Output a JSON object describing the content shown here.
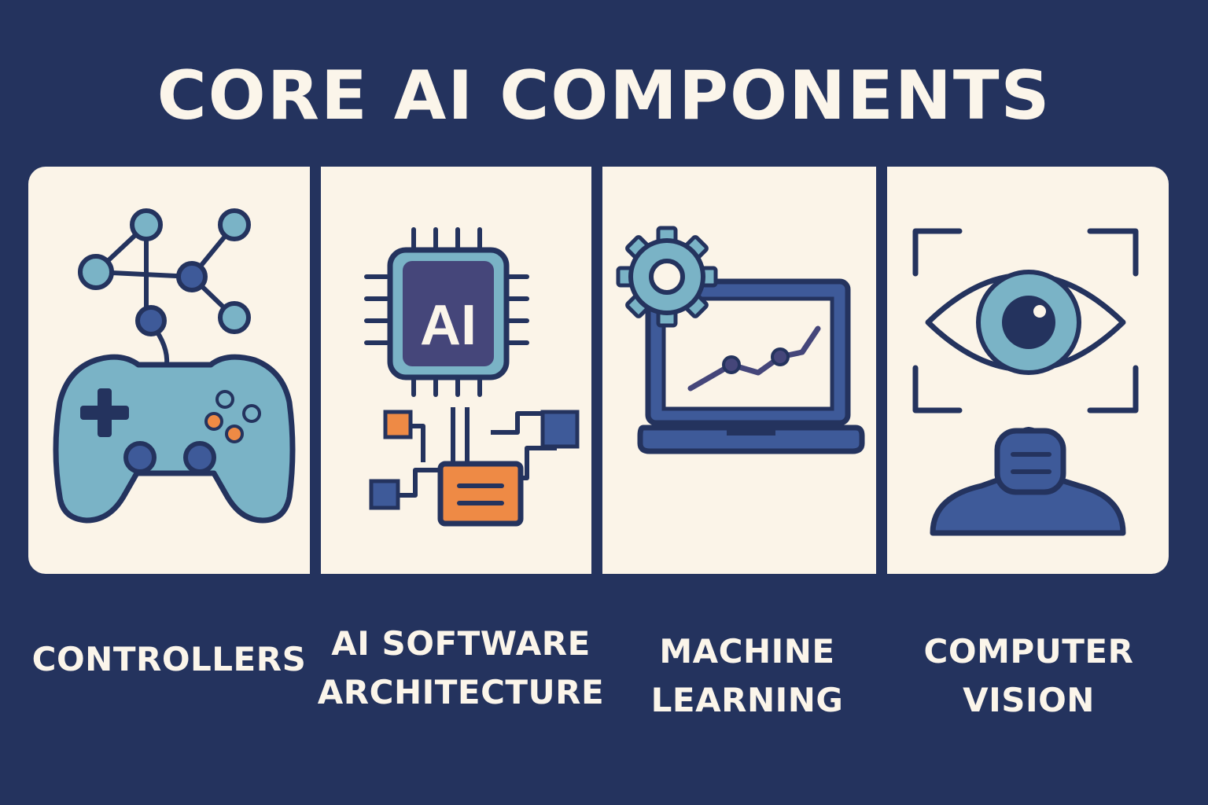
{
  "title": "CORE AI COMPONENTS",
  "colors": {
    "background": "#24335e",
    "panel": "#fbf4e8",
    "outline": "#24335e",
    "light_blue": "#7ab3c6",
    "mid_blue": "#3e5a99",
    "purple": "#45467a",
    "orange": "#ee8a45"
  },
  "panels": [
    {
      "icon": "gamepad-network-icon",
      "caption_lines": [
        "CONTROLLERS"
      ]
    },
    {
      "icon": "ai-chip-icon",
      "chip_label": "AI",
      "caption_lines": [
        "AI SOFTWARE",
        "ARCHITECTURE"
      ]
    },
    {
      "icon": "laptop-gear-chart-icon",
      "caption_lines": [
        "MACHINE",
        "LEARNING"
      ]
    },
    {
      "icon": "eye-scan-person-icon",
      "caption_lines": [
        "COMPUTER",
        "VISION"
      ]
    }
  ]
}
